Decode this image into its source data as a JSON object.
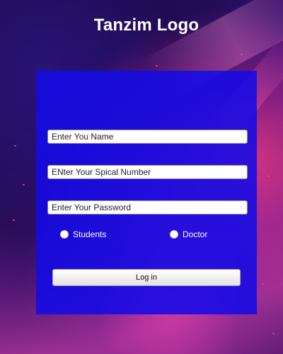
{
  "header": {
    "title": "Tanzim Logo"
  },
  "form": {
    "name_placeholder": "Enter You Name",
    "special_number_placeholder": "ENter Your Spical Number",
    "password_placeholder": "Enter Your Password",
    "roles": [
      {
        "label": "Students",
        "selected": false
      },
      {
        "label": "Doctor",
        "selected": false
      }
    ],
    "login_label": "Log in"
  },
  "colors": {
    "card": "#1a10e6",
    "title": "#ffffff"
  }
}
